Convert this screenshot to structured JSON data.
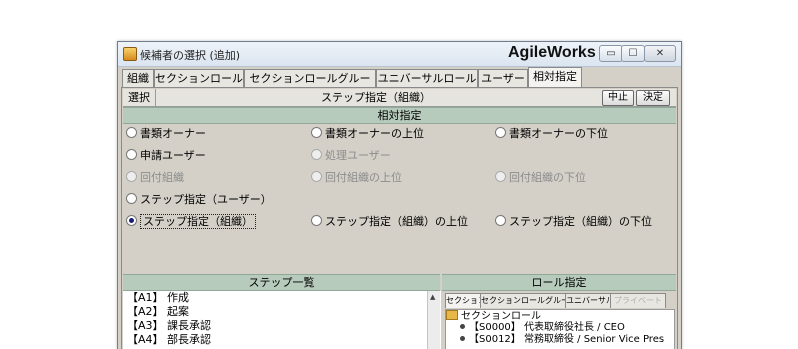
{
  "window": {
    "title": "候補者の選択 (追加)",
    "brand": "AgileWorks",
    "controls": {
      "minimize": "▭",
      "maximize": "☐",
      "close": "✕"
    }
  },
  "tabs": [
    {
      "label": "組織",
      "active": false
    },
    {
      "label": "セクションロール",
      "active": false
    },
    {
      "label": "セクションロールグループ",
      "active": false
    },
    {
      "label": "ユニバーサルロール",
      "active": false
    },
    {
      "label": "ユーザー",
      "active": false
    },
    {
      "label": "相対指定",
      "active": true
    }
  ],
  "toolbar": {
    "select_label": "選択",
    "center_label": "ステップ指定（組織）",
    "cancel_label": "中止",
    "confirm_label": "決定"
  },
  "relative": {
    "header": "相対指定",
    "options": [
      {
        "label": "書類オーナー",
        "enabled": true,
        "selected": false
      },
      {
        "label": "書類オーナーの上位",
        "enabled": true,
        "selected": false
      },
      {
        "label": "書類オーナーの下位",
        "enabled": true,
        "selected": false
      },
      {
        "label": "申請ユーザー",
        "enabled": true,
        "selected": false
      },
      {
        "label": "処理ユーザー",
        "enabled": false,
        "selected": false
      },
      {
        "label": "回付組織",
        "enabled": false,
        "selected": false
      },
      {
        "label": "回付組織の上位",
        "enabled": false,
        "selected": false
      },
      {
        "label": "回付組織の下位",
        "enabled": false,
        "selected": false
      },
      {
        "label": "ステップ指定（ユーザー）",
        "enabled": true,
        "selected": false
      },
      {
        "label": "ステップ指定（組織）",
        "enabled": true,
        "selected": true
      },
      {
        "label": "ステップ指定（組織）の上位",
        "enabled": true,
        "selected": false
      },
      {
        "label": "ステップ指定（組織）の下位",
        "enabled": true,
        "selected": false
      }
    ]
  },
  "step_list": {
    "header": "ステップ一覧",
    "items": [
      "【A1】 作成",
      "【A2】 起案",
      "【A3】 課長承認",
      "【A4】 部長承認"
    ]
  },
  "role_panel": {
    "header": "ロール指定",
    "tabs": [
      {
        "label": "セクション",
        "active": true,
        "enabled": true
      },
      {
        "label": "セクションロールグループ",
        "active": false,
        "enabled": true
      },
      {
        "label": "ユニバーサル",
        "active": false,
        "enabled": true
      },
      {
        "label": "プライベート",
        "active": false,
        "enabled": false
      }
    ],
    "tree": {
      "root": "セクションロール",
      "children": [
        "【S0000】 代表取締役社長 / CEO",
        "【S0012】 常務取締役 / Senior Vice Pres"
      ]
    }
  }
}
